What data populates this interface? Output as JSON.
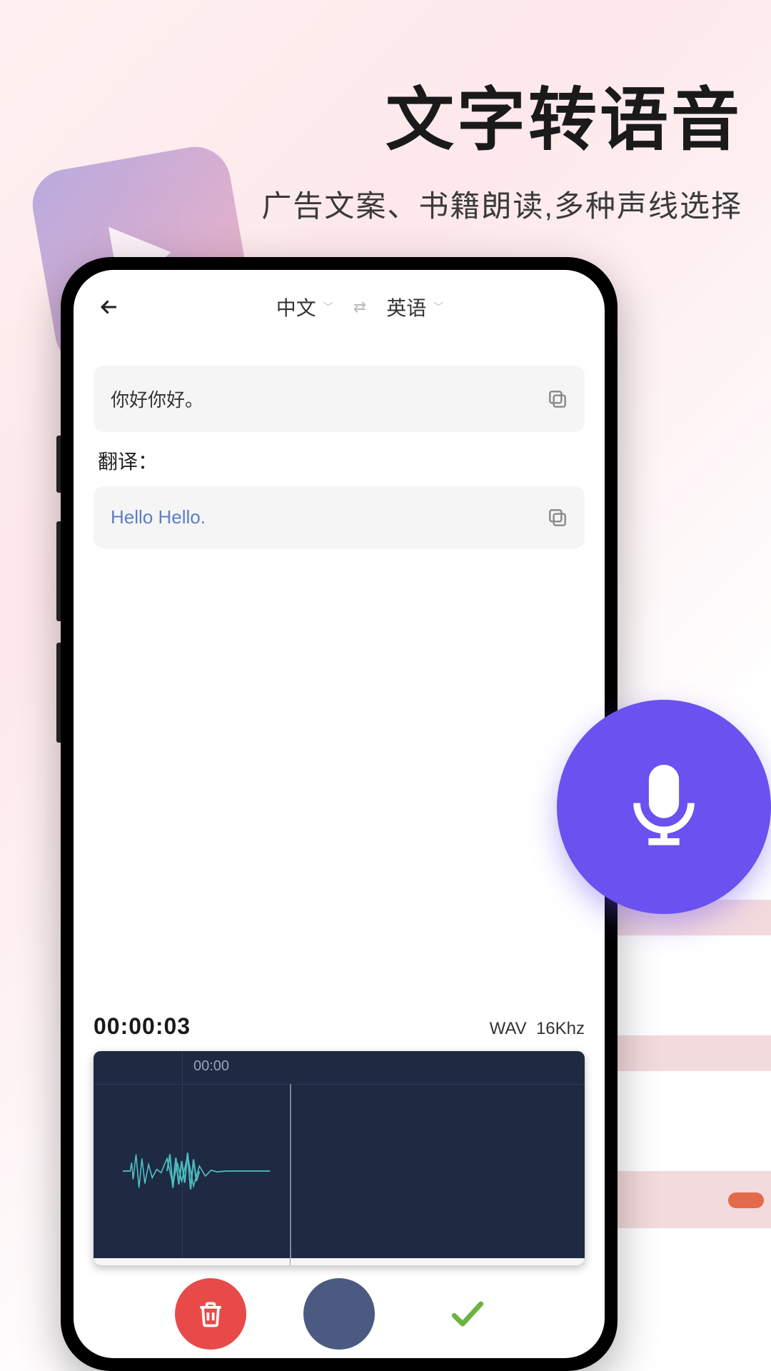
{
  "hero": {
    "title": "文字转语音",
    "subtitle": "广告文案、书籍朗读,多种声线选择"
  },
  "topbar": {
    "source_lang": "中文",
    "target_lang": "英语"
  },
  "input": {
    "text": "你好你好。"
  },
  "translation": {
    "label": "翻译：",
    "text": "Hello Hello."
  },
  "audio": {
    "time": "00:00:03",
    "format": "WAV",
    "sample_rate": "16Khz",
    "marker_time": "00:00"
  },
  "colors": {
    "accent": "#6a51f0",
    "danger": "#e84a4a",
    "record": "#4a5a80",
    "waveform_bg": "#1e2942"
  }
}
